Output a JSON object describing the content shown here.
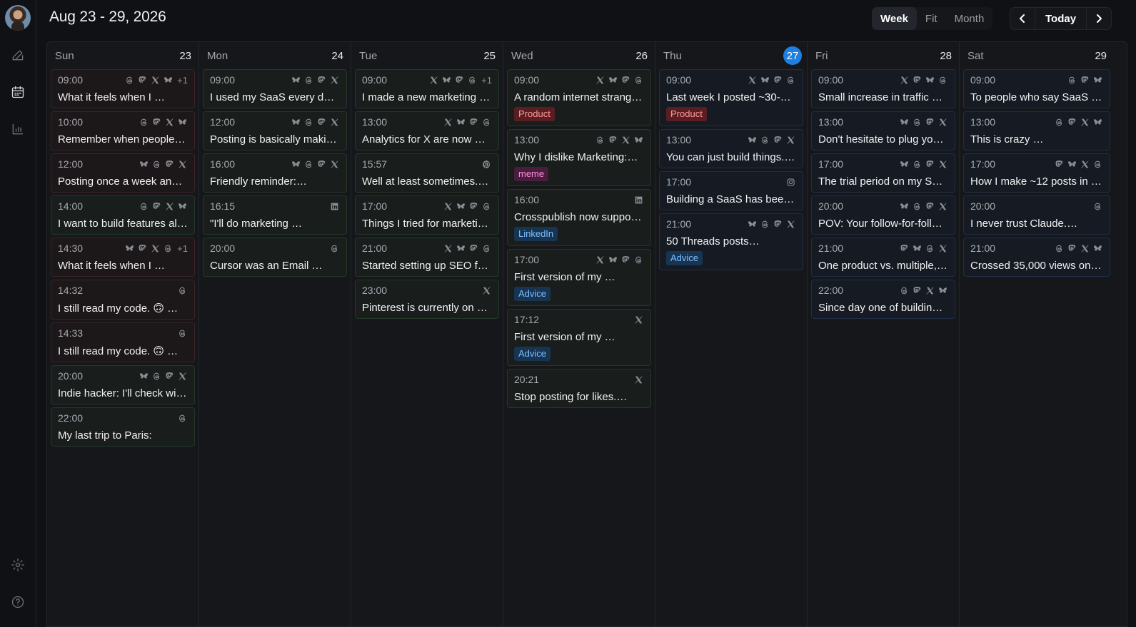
{
  "header": {
    "title": "Aug 23 - 29, 2026",
    "views": [
      "Week",
      "Fit",
      "Month"
    ],
    "active_view": "Week",
    "today_label": "Today"
  },
  "colors": {
    "accent": "#1f7fe0",
    "background": "#0f1115",
    "panel": "#15171b"
  },
  "sidebar": {
    "items": [
      "avatar",
      "compose-icon",
      "calendar-icon",
      "analytics-icon",
      "settings-icon",
      "help-icon"
    ]
  },
  "days": [
    {
      "name": "Sun",
      "num": "23",
      "today": false,
      "events": [
        {
          "time": "09:00",
          "icons": [
            "threads",
            "mastodon",
            "x",
            "bluesky"
          ],
          "more": "+1",
          "text": "What it feels when I …",
          "tone": "red"
        },
        {
          "time": "10:00",
          "icons": [
            "threads",
            "mastodon",
            "x",
            "bluesky"
          ],
          "text": "Remember when people …",
          "tone": "red"
        },
        {
          "time": "12:00",
          "icons": [
            "bluesky",
            "threads",
            "mastodon",
            "x"
          ],
          "text": "Posting once a week and …",
          "tone": "red"
        },
        {
          "time": "14:00",
          "icons": [
            "threads",
            "mastodon",
            "x",
            "bluesky"
          ],
          "text": "I want to build features all …",
          "tone": "green"
        },
        {
          "time": "14:30",
          "icons": [
            "bluesky",
            "mastodon",
            "x",
            "threads"
          ],
          "more": "+1",
          "text": "What it feels when I …",
          "tone": "red"
        },
        {
          "time": "14:32",
          "icons": [
            "threads"
          ],
          "text": "I still read my code. 🙃 …",
          "tone": "red"
        },
        {
          "time": "14:33",
          "icons": [
            "threads"
          ],
          "text": "I still read my code. 🙃 …",
          "tone": "red"
        },
        {
          "time": "20:00",
          "icons": [
            "bluesky",
            "threads",
            "mastodon",
            "x"
          ],
          "text": "Indie hacker: I'll check wit…",
          "tone": "green"
        },
        {
          "time": "22:00",
          "icons": [
            "threads"
          ],
          "text": "My last trip to Paris:",
          "tone": "green"
        }
      ]
    },
    {
      "name": "Mon",
      "num": "24",
      "today": false,
      "events": [
        {
          "time": "09:00",
          "icons": [
            "bluesky",
            "threads",
            "mastodon",
            "x"
          ],
          "text": "I used my SaaS every day …",
          "tone": "green"
        },
        {
          "time": "12:00",
          "icons": [
            "bluesky",
            "threads",
            "mastodon",
            "x"
          ],
          "text": "Posting is basically makin…",
          "tone": "green"
        },
        {
          "time": "16:00",
          "icons": [
            "bluesky",
            "threads",
            "mastodon",
            "x"
          ],
          "text": "Friendly reminder:…",
          "tone": "green"
        },
        {
          "time": "16:15",
          "icons": [
            "linkedin"
          ],
          "text": "\"I'll do marketing …",
          "tone": "green"
        },
        {
          "time": "20:00",
          "icons": [
            "threads"
          ],
          "text": "Cursor was an Email …",
          "tone": "green"
        }
      ]
    },
    {
      "name": "Tue",
      "num": "25",
      "today": false,
      "events": [
        {
          "time": "09:00",
          "icons": [
            "x",
            "bluesky",
            "mastodon",
            "threads"
          ],
          "more": "+1",
          "text": "I made a new marketing …",
          "tone": "green"
        },
        {
          "time": "13:00",
          "icons": [
            "x",
            "bluesky",
            "mastodon",
            "threads"
          ],
          "text": "Analytics for X are now …",
          "tone": "green"
        },
        {
          "time": "15:57",
          "icons": [
            "pinterest"
          ],
          "text": "Well at least sometimes.…",
          "tone": "green"
        },
        {
          "time": "17:00",
          "icons": [
            "x",
            "bluesky",
            "mastodon",
            "threads"
          ],
          "text": "Things I tried for marketin…",
          "tone": "green"
        },
        {
          "time": "21:00",
          "icons": [
            "x",
            "bluesky",
            "mastodon",
            "threads"
          ],
          "text": "Started setting up SEO for…",
          "tone": "green"
        },
        {
          "time": "23:00",
          "icons": [
            "x"
          ],
          "text": "Pinterest is currently on …",
          "tone": "green"
        }
      ]
    },
    {
      "name": "Wed",
      "num": "26",
      "today": false,
      "events": [
        {
          "time": "09:00",
          "icons": [
            "x",
            "bluesky",
            "mastodon",
            "threads"
          ],
          "text": "A random internet strange…",
          "tag": "Product",
          "tagtype": "product",
          "tone": "green"
        },
        {
          "time": "13:00",
          "icons": [
            "threads",
            "mastodon",
            "x",
            "bluesky"
          ],
          "text": "Why I dislike Marketing:…",
          "tag": "meme",
          "tagtype": "meme",
          "tone": "green"
        },
        {
          "time": "16:00",
          "icons": [
            "linkedin"
          ],
          "text": "Crosspublish now support…",
          "tag": "LinkedIn",
          "tagtype": "linkedin",
          "tone": "green"
        },
        {
          "time": "17:00",
          "icons": [
            "x",
            "bluesky",
            "mastodon",
            "threads"
          ],
          "text": "First version of my …",
          "tag": "Advice",
          "tagtype": "advice",
          "tone": "green"
        },
        {
          "time": "17:12",
          "icons": [
            "x"
          ],
          "text": "First version of my …",
          "tag": "Advice",
          "tagtype": "advice",
          "tone": "green"
        },
        {
          "time": "20:21",
          "icons": [
            "x"
          ],
          "text": "Stop posting for likes.…",
          "tone": "green"
        }
      ]
    },
    {
      "name": "Thu",
      "num": "27",
      "today": true,
      "events": [
        {
          "time": "09:00",
          "icons": [
            "x",
            "bluesky",
            "mastodon",
            "threads"
          ],
          "text": "Last week I posted ~30-…",
          "tag": "Product",
          "tagtype": "product",
          "tone": "blue"
        },
        {
          "time": "13:00",
          "icons": [
            "bluesky",
            "threads",
            "mastodon",
            "x"
          ],
          "text": "You can just build things.…",
          "tone": "blue"
        },
        {
          "time": "17:00",
          "icons": [
            "instagram"
          ],
          "text": "Building a SaaS has been …",
          "tone": "blue"
        },
        {
          "time": "21:00",
          "icons": [
            "bluesky",
            "threads",
            "mastodon",
            "x"
          ],
          "text": "50 Threads posts…",
          "tag": "Advice",
          "tagtype": "advice",
          "tone": "blue"
        }
      ]
    },
    {
      "name": "Fri",
      "num": "28",
      "today": false,
      "events": [
        {
          "time": "09:00",
          "icons": [
            "x",
            "mastodon",
            "bluesky",
            "threads"
          ],
          "text": "Small increase in traffic …",
          "tone": "blue"
        },
        {
          "time": "13:00",
          "icons": [
            "bluesky",
            "threads",
            "mastodon",
            "x"
          ],
          "text": "Don't hesitate to plug your…",
          "tone": "blue"
        },
        {
          "time": "17:00",
          "icons": [
            "bluesky",
            "threads",
            "mastodon",
            "x"
          ],
          "text": "The trial period on my Saa…",
          "tone": "blue"
        },
        {
          "time": "20:00",
          "icons": [
            "bluesky",
            "threads",
            "mastodon",
            "x"
          ],
          "text": "POV: Your follow-for-follo…",
          "tone": "blue"
        },
        {
          "time": "21:00",
          "icons": [
            "mastodon",
            "bluesky",
            "threads",
            "x"
          ],
          "text": "One product vs. multiple, …",
          "tone": "blue"
        },
        {
          "time": "22:00",
          "icons": [
            "threads",
            "mastodon",
            "x",
            "bluesky"
          ],
          "text": "Since day one of building …",
          "tone": "blue"
        }
      ]
    },
    {
      "name": "Sat",
      "num": "29",
      "today": false,
      "events": [
        {
          "time": "09:00",
          "icons": [
            "threads",
            "mastodon",
            "bluesky"
          ],
          "text": "To people who say SaaS is…",
          "tone": "blue"
        },
        {
          "time": "13:00",
          "icons": [
            "threads",
            "mastodon",
            "x",
            "bluesky"
          ],
          "text": "This is crazy …",
          "tone": "blue"
        },
        {
          "time": "17:00",
          "icons": [
            "mastodon",
            "bluesky",
            "x",
            "threads"
          ],
          "text": "How I make ~12 posts in 1…",
          "tone": "blue"
        },
        {
          "time": "20:00",
          "icons": [
            "threads"
          ],
          "text": "I never trust Claude.…",
          "tone": "blue"
        },
        {
          "time": "21:00",
          "icons": [
            "threads",
            "mastodon",
            "x",
            "bluesky"
          ],
          "text": "Crossed 35,000 views on …",
          "tone": "blue"
        }
      ]
    }
  ]
}
